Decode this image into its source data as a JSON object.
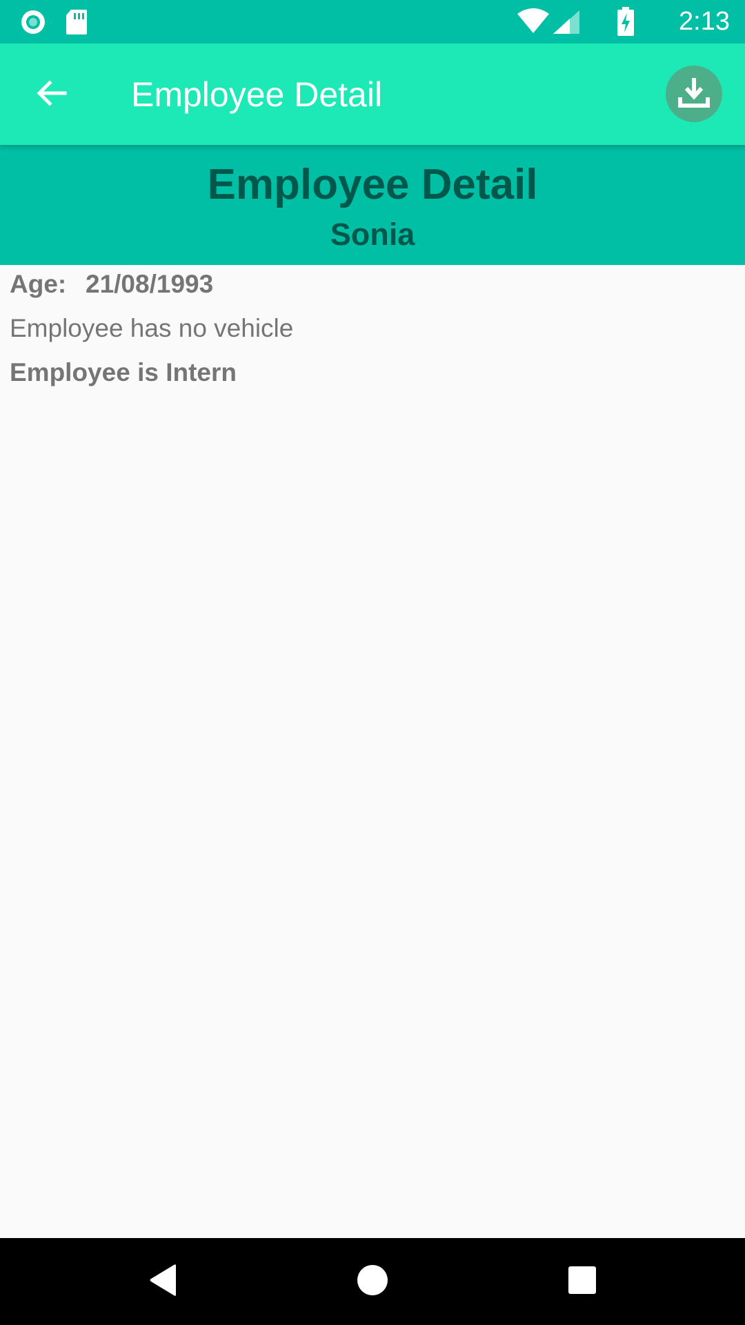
{
  "status_bar": {
    "time": "2:13",
    "left_icons": [
      "record-icon",
      "sd-card-icon"
    ],
    "right_icons": [
      "wifi-icon",
      "signal-icon",
      "battery-charging-icon"
    ],
    "color": "#00bfa5"
  },
  "app_bar": {
    "title": "Employee Detail",
    "back_icon": "arrow-back-icon",
    "action_icon": "download-icon",
    "color": "#1de9b6"
  },
  "header": {
    "title": "Employee Detail",
    "name": "Sonia",
    "text_color": "#00574b"
  },
  "details": {
    "age_label": "Age:",
    "age_value": "21/08/1993",
    "vehicle_text": "Employee has no vehicle",
    "role_text": "Employee is Intern"
  },
  "nav_bar": {
    "buttons": [
      "back-triangle-icon",
      "home-circle-icon",
      "recents-square-icon"
    ]
  }
}
